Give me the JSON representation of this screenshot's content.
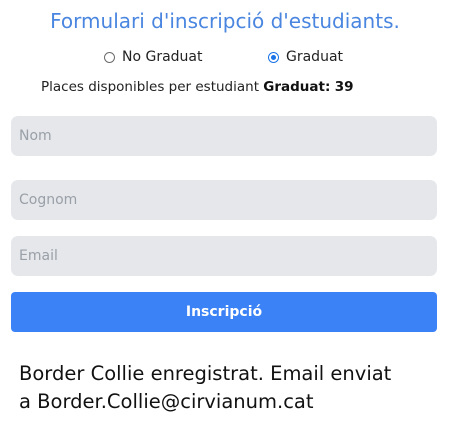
{
  "form": {
    "title": "Formulari d'inscripció d'estudiants.",
    "options": [
      {
        "label": "No Graduat",
        "selected": false
      },
      {
        "label": "Graduat",
        "selected": true
      }
    ],
    "places_prefix": "Places disponibles per estudiant ",
    "places_category": "Graduat:",
    "places_count": "39",
    "fields": {
      "nom_placeholder": "Nom",
      "cognom_placeholder": "Cognom",
      "email_placeholder": "Email"
    },
    "submit_label": "Inscripció"
  },
  "result": {
    "line1": "Border Collie enregistrat. Email enviat",
    "line2": "a Border.Collie@cirvianum.cat"
  },
  "colors": {
    "title": "#4a86e0",
    "button": "#3b82f6",
    "field_bg": "#e5e7eb"
  }
}
